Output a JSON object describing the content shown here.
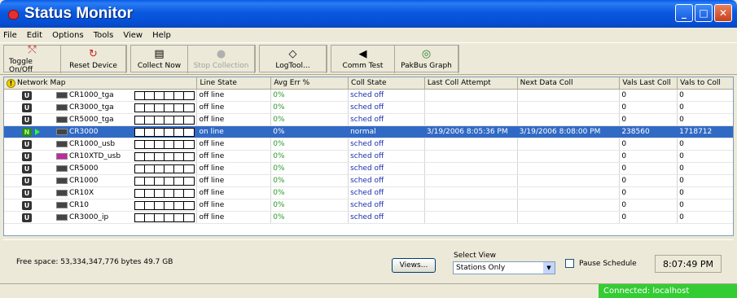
{
  "window": {
    "title": "Status Monitor",
    "min": "_",
    "max": "□",
    "close": "✕"
  },
  "menu": [
    "File",
    "Edit",
    "Options",
    "Tools",
    "View",
    "Help"
  ],
  "toolbar": [
    {
      "label": "Toggle On/Off",
      "icon": "toggle-icon",
      "glyph": "⤲",
      "enabled": true
    },
    {
      "label": "Reset Device",
      "icon": "reset-icon",
      "glyph": "↻",
      "enabled": true
    },
    {
      "label": "Collect Now",
      "icon": "collect-icon",
      "glyph": "▤",
      "enabled": true
    },
    {
      "label": "Stop Collection",
      "icon": "stop-icon",
      "glyph": "●",
      "enabled": false
    },
    {
      "label": "LogTool...",
      "icon": "logtool-icon",
      "glyph": "◇",
      "enabled": true
    },
    {
      "label": "Comm Test",
      "icon": "comm-test-icon",
      "glyph": "◀",
      "enabled": true
    },
    {
      "label": "PakBus Graph",
      "icon": "pakbus-graph-icon",
      "glyph": "◎",
      "enabled": true
    }
  ],
  "columns": [
    "Network Map",
    "Line State",
    "Avg Err %",
    "Coll State",
    "Last Coll Attempt",
    "Next Data Coll",
    "Vals Last Coll",
    "Vals to Coll"
  ],
  "rows": [
    {
      "status": "U",
      "device": "CR1000_tga",
      "line": "off line",
      "avg": "0%",
      "coll": "sched off",
      "last": "",
      "next": "",
      "vals_last": "0",
      "vals_to": "0",
      "selected": false,
      "usb": false
    },
    {
      "status": "U",
      "device": "CR3000_tga",
      "line": "off line",
      "avg": "0%",
      "coll": "sched off",
      "last": "",
      "next": "",
      "vals_last": "0",
      "vals_to": "0",
      "selected": false,
      "usb": false
    },
    {
      "status": "U",
      "device": "CR5000_tga",
      "line": "off line",
      "avg": "0%",
      "coll": "sched off",
      "last": "",
      "next": "",
      "vals_last": "0",
      "vals_to": "0",
      "selected": false,
      "usb": false
    },
    {
      "status": "N",
      "device": "CR3000",
      "line": "on line",
      "avg": "0%",
      "coll": "normal",
      "last": "3/19/2006 8:05:36 PM",
      "next": "3/19/2006 8:08:00 PM",
      "vals_last": "238560",
      "vals_to": "1718712",
      "selected": true,
      "usb": false
    },
    {
      "status": "U",
      "device": "CR1000_usb",
      "line": "off line",
      "avg": "0%",
      "coll": "sched off",
      "last": "",
      "next": "",
      "vals_last": "0",
      "vals_to": "0",
      "selected": false,
      "usb": false
    },
    {
      "status": "U",
      "device": "CR10XTD_usb",
      "line": "off line",
      "avg": "0%",
      "coll": "sched off",
      "last": "",
      "next": "",
      "vals_last": "0",
      "vals_to": "0",
      "selected": false,
      "usb": true
    },
    {
      "status": "U",
      "device": "CR5000",
      "line": "off line",
      "avg": "0%",
      "coll": "sched off",
      "last": "",
      "next": "",
      "vals_last": "0",
      "vals_to": "0",
      "selected": false,
      "usb": false
    },
    {
      "status": "U",
      "device": "CR1000",
      "line": "off line",
      "avg": "0%",
      "coll": "sched off",
      "last": "",
      "next": "",
      "vals_last": "0",
      "vals_to": "0",
      "selected": false,
      "usb": false
    },
    {
      "status": "U",
      "device": "CR10X",
      "line": "off line",
      "avg": "0%",
      "coll": "sched off",
      "last": "",
      "next": "",
      "vals_last": "0",
      "vals_to": "0",
      "selected": false,
      "usb": false
    },
    {
      "status": "U",
      "device": "CR10",
      "line": "off line",
      "avg": "0%",
      "coll": "sched off",
      "last": "",
      "next": "",
      "vals_last": "0",
      "vals_to": "0",
      "selected": false,
      "usb": false
    },
    {
      "status": "U",
      "device": "CR3000_ip",
      "line": "off line",
      "avg": "0%",
      "coll": "sched off",
      "last": "",
      "next": "",
      "vals_last": "0",
      "vals_to": "0",
      "selected": false,
      "usb": false
    }
  ],
  "bottom": {
    "free_space": "Free space: 53,334,347,776 bytes   49.7 GB",
    "views_button": "Views...",
    "select_label": "Select View",
    "select_value": "Stations Only",
    "pause_label": "Pause Schedule",
    "clock": "8:07:49 PM"
  },
  "status": {
    "connected": "Connected: localhost"
  }
}
